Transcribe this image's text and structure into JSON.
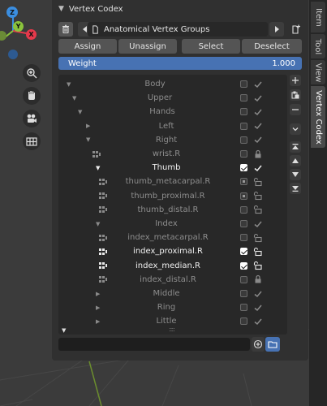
{
  "panel": {
    "title": "Vertex Codex",
    "group_name": "Anatomical Vertex Groups",
    "buttons": {
      "assign": "Assign",
      "unassign": "Unassign",
      "select": "Select",
      "deselect": "Deselect"
    },
    "weight": {
      "label": "Weight",
      "value": "1.000",
      "fraction": 1.0
    }
  },
  "tree": [
    {
      "label": "Body",
      "depth": 0,
      "expander": "down",
      "icon": "none",
      "check": "off",
      "state": "check",
      "highlight": false
    },
    {
      "label": "Upper",
      "depth": 1,
      "expander": "down",
      "icon": "none",
      "check": "off",
      "state": "check",
      "highlight": false
    },
    {
      "label": "Hands",
      "depth": 2,
      "expander": "down",
      "icon": "none",
      "check": "off",
      "state": "check",
      "highlight": false
    },
    {
      "label": "Left",
      "depth": 3,
      "expander": "right",
      "icon": "none",
      "check": "off",
      "state": "check",
      "highlight": false
    },
    {
      "label": "Right",
      "depth": 3,
      "expander": "down",
      "icon": "none",
      "check": "off",
      "state": "check",
      "highlight": false
    },
    {
      "label": "wrist.R",
      "depth": 4,
      "expander": "none",
      "icon": "group",
      "check": "off",
      "state": "lock",
      "highlight": false
    },
    {
      "label": "Thumb",
      "depth": 4,
      "expander": "down",
      "icon": "none",
      "check": "on",
      "state": "check",
      "highlight": true
    },
    {
      "label": "thumb_metacarpal.R",
      "depth": 5,
      "expander": "none",
      "icon": "group",
      "check": "dot",
      "state": "unlock",
      "highlight": false
    },
    {
      "label": "thumb_proximal.R",
      "depth": 5,
      "expander": "none",
      "icon": "group",
      "check": "dot",
      "state": "unlock",
      "highlight": false
    },
    {
      "label": "thumb_distal.R",
      "depth": 5,
      "expander": "none",
      "icon": "group",
      "check": "off",
      "state": "unlock",
      "highlight": false
    },
    {
      "label": "Index",
      "depth": 4,
      "expander": "down",
      "icon": "none",
      "check": "off",
      "state": "check",
      "highlight": false
    },
    {
      "label": "index_metacarpal.R",
      "depth": 5,
      "expander": "none",
      "icon": "group",
      "check": "off",
      "state": "unlock",
      "highlight": false
    },
    {
      "label": "index_proximal.R",
      "depth": 5,
      "expander": "none",
      "icon": "group",
      "check": "on",
      "state": "unlock",
      "highlight": true
    },
    {
      "label": "index_median.R",
      "depth": 5,
      "expander": "none",
      "icon": "group",
      "check": "on",
      "state": "unlock",
      "highlight": true
    },
    {
      "label": "index_distal.R",
      "depth": 5,
      "expander": "none",
      "icon": "group",
      "check": "off",
      "state": "lock",
      "highlight": false
    },
    {
      "label": "Middle",
      "depth": 4,
      "expander": "right",
      "icon": "none",
      "check": "off",
      "state": "check",
      "highlight": false
    },
    {
      "label": "Ring",
      "depth": 4,
      "expander": "right",
      "icon": "none",
      "check": "off",
      "state": "check",
      "highlight": false
    },
    {
      "label": "Little",
      "depth": 4,
      "expander": "right",
      "icon": "none",
      "check": "off",
      "state": "check",
      "highlight": false
    }
  ],
  "gizmo": {
    "z": "Z",
    "y": "Y",
    "x": "X"
  },
  "tabs": [
    {
      "label": "Item",
      "active": false
    },
    {
      "label": "Tool",
      "active": false
    },
    {
      "label": "View",
      "active": false
    },
    {
      "label": "Vertex Codex",
      "active": true
    }
  ],
  "icons": {
    "delete": "trash-icon",
    "doc": "document-icon",
    "prev": "triangle-left-icon",
    "next": "triangle-right-icon",
    "newdoc": "new-document-icon",
    "add": "plus-icon",
    "paste": "paste-icon",
    "remove": "minus-icon",
    "menu": "chevron-down-icon",
    "top": "move-top-icon",
    "up": "move-up-icon",
    "down": "move-down-icon",
    "bottom": "move-bottom-icon",
    "zoom": "zoom-icon",
    "hand": "hand-icon",
    "camera": "camera-icon",
    "grid": "grid-icon"
  },
  "colors": {
    "accent": "#4772b3",
    "x_axis": "#e5394b",
    "y_axis": "#8ac33c",
    "z_axis": "#3b8ee0"
  }
}
